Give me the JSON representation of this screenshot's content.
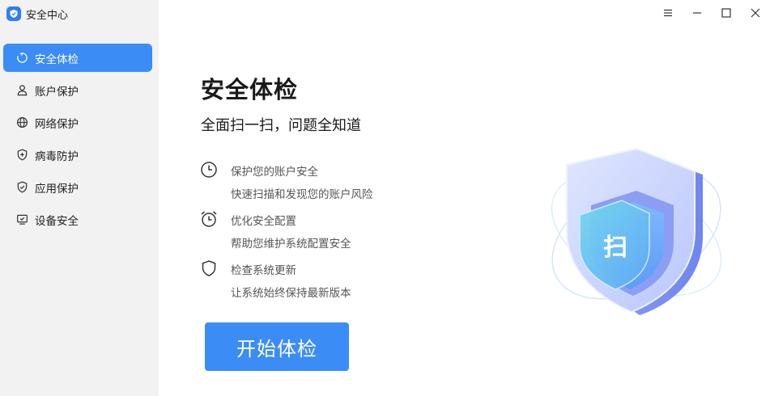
{
  "app": {
    "title": "安全中心"
  },
  "sidebar": {
    "items": [
      {
        "label": "安全体检",
        "icon": "refresh-circle-icon",
        "active": true
      },
      {
        "label": "账户保护",
        "icon": "user-icon",
        "active": false
      },
      {
        "label": "网络保护",
        "icon": "globe-icon",
        "active": false
      },
      {
        "label": "病毒防护",
        "icon": "shield-plus-icon",
        "active": false
      },
      {
        "label": "应用保护",
        "icon": "shield-check-icon",
        "active": false
      },
      {
        "label": "设备安全",
        "icon": "monitor-check-icon",
        "active": false
      }
    ]
  },
  "window_controls": [
    "menu-icon",
    "minimize-icon",
    "maximize-icon",
    "close-icon"
  ],
  "main": {
    "title": "安全体检",
    "subtitle": "全面扫一扫，问题全知道",
    "features": [
      {
        "icon": "clock-icon",
        "title": "保护您的账户安全",
        "desc": "快速扫描和发现您的账户风险"
      },
      {
        "icon": "alarm-clock-icon",
        "title": "优化安全配置",
        "desc": "帮助您维护系统配置安全"
      },
      {
        "icon": "shield-icon",
        "title": "检查系统更新",
        "desc": "让系统始终保持最新版本"
      }
    ],
    "start_button": "开始体检",
    "illustration_label": "扫"
  },
  "colors": {
    "accent": "#3b8cf5",
    "sidebar_bg": "#f2f2f2"
  }
}
